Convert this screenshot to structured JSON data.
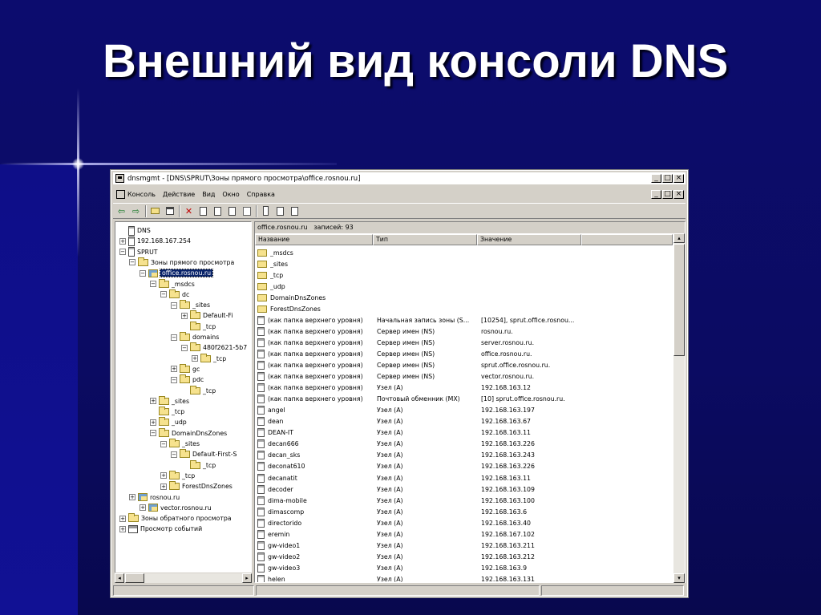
{
  "slide": {
    "title": "Внешний вид консоли DNS"
  },
  "window": {
    "title": "dnsmgmt - [DNS\\SPRUT\\Зоны прямого просмотра\\office.rosnou.ru]",
    "controls": {
      "minimize": "_",
      "maximize": "□",
      "close": "×"
    }
  },
  "menu": {
    "items": [
      "Консоль",
      "Действие",
      "Вид",
      "Окно",
      "Справка"
    ]
  },
  "toolbar": {
    "back": "⇦",
    "forward": "⇨",
    "delete": "✕"
  },
  "tree": {
    "nodes": [
      {
        "label": "DNS",
        "icon": "dns-icon",
        "toggle": ""
      },
      {
        "label": "192.168.167.254",
        "icon": "server-icon",
        "toggle": "+"
      },
      {
        "label": "SPRUT",
        "icon": "server-icon",
        "toggle": "−"
      },
      {
        "label": "Зоны прямого просмотра",
        "icon": "folder-icon",
        "toggle": "−"
      },
      {
        "label": "office.rosnou.ru",
        "icon": "zone-icon",
        "toggle": "−",
        "selected": true
      },
      {
        "label": "_msdcs",
        "icon": "folder-icon",
        "toggle": "−"
      },
      {
        "label": "dc",
        "icon": "folder-icon",
        "toggle": "−"
      },
      {
        "label": "_sites",
        "icon": "folder-icon",
        "toggle": "−"
      },
      {
        "label": "Default-Fi",
        "icon": "folder-icon",
        "toggle": "+"
      },
      {
        "label": "_tcp",
        "icon": "folder-icon",
        "toggle": ""
      },
      {
        "label": "domains",
        "icon": "folder-icon",
        "toggle": "−"
      },
      {
        "label": "480f2621-5b7",
        "icon": "folder-icon",
        "toggle": "−"
      },
      {
        "label": "_tcp",
        "icon": "folder-icon",
        "toggle": "+"
      },
      {
        "label": "gc",
        "icon": "folder-icon",
        "toggle": "+"
      },
      {
        "label": "pdc",
        "icon": "folder-icon",
        "toggle": "−"
      },
      {
        "label": "_tcp",
        "icon": "folder-icon",
        "toggle": ""
      },
      {
        "label": "_sites",
        "icon": "folder-icon",
        "toggle": "+"
      },
      {
        "label": "_tcp",
        "icon": "folder-icon",
        "toggle": ""
      },
      {
        "label": "_udp",
        "icon": "folder-icon",
        "toggle": "+"
      },
      {
        "label": "DomainDnsZones",
        "icon": "folder-icon",
        "toggle": "−"
      },
      {
        "label": "_sites",
        "icon": "folder-icon",
        "toggle": "−"
      },
      {
        "label": "Default-First-S",
        "icon": "folder-icon",
        "toggle": "−"
      },
      {
        "label": "_tcp",
        "icon": "folder-icon",
        "toggle": ""
      },
      {
        "label": "_tcp",
        "icon": "folder-icon",
        "toggle": "+"
      },
      {
        "label": "ForestDnsZones",
        "icon": "folder-icon",
        "toggle": "+"
      },
      {
        "label": "rosnou.ru",
        "icon": "zone-icon",
        "toggle": "+"
      },
      {
        "label": "vector.rosnou.ru",
        "icon": "zone-icon",
        "toggle": "+"
      },
      {
        "label": "Зоны обратного просмотра",
        "icon": "folder-icon",
        "toggle": "+"
      },
      {
        "label": "Просмотр событий",
        "icon": "event-viewer-icon",
        "toggle": "+"
      }
    ]
  },
  "list": {
    "header": "office.rosnou.ru   записей: 93",
    "columns": [
      "Название",
      "Тип",
      "Значение"
    ],
    "rows": [
      {
        "name": "_msdcs",
        "type": "",
        "value": "",
        "icon": "folder-icon"
      },
      {
        "name": "_sites",
        "type": "",
        "value": "",
        "icon": "folder-icon"
      },
      {
        "name": "_tcp",
        "type": "",
        "value": "",
        "icon": "folder-icon"
      },
      {
        "name": "_udp",
        "type": "",
        "value": "",
        "icon": "folder-icon"
      },
      {
        "name": "DomainDnsZones",
        "type": "",
        "value": "",
        "icon": "folder-icon"
      },
      {
        "name": "ForestDnsZones",
        "type": "",
        "value": "",
        "icon": "folder-icon"
      },
      {
        "name": "(как папка верхнего уровня)",
        "type": "Начальная запись зоны (S...",
        "value": "[10254], sprut.office.rosnou...",
        "icon": "record-icon"
      },
      {
        "name": "(как папка верхнего уровня)",
        "type": "Сервер имен (NS)",
        "value": "rosnou.ru.",
        "icon": "record-icon"
      },
      {
        "name": "(как папка верхнего уровня)",
        "type": "Сервер имен (NS)",
        "value": "server.rosnou.ru.",
        "icon": "record-icon"
      },
      {
        "name": "(как папка верхнего уровня)",
        "type": "Сервер имен (NS)",
        "value": "office.rosnou.ru.",
        "icon": "record-icon"
      },
      {
        "name": "(как папка верхнего уровня)",
        "type": "Сервер имен (NS)",
        "value": "sprut.office.rosnou.ru.",
        "icon": "record-icon"
      },
      {
        "name": "(как папка верхнего уровня)",
        "type": "Сервер имен (NS)",
        "value": "vector.rosnou.ru.",
        "icon": "record-icon"
      },
      {
        "name": "(как папка верхнего уровня)",
        "type": "Узел (A)",
        "value": "192.168.163.12",
        "icon": "record-icon"
      },
      {
        "name": "(как папка верхнего уровня)",
        "type": "Почтовый обменник (MX)",
        "value": "[10]  sprut.office.rosnou.ru.",
        "icon": "record-icon"
      },
      {
        "name": "angel",
        "type": "Узел (A)",
        "value": "192.168.163.197",
        "icon": "record-icon"
      },
      {
        "name": "dean",
        "type": "Узел (A)",
        "value": "192.168.163.67",
        "icon": "record-icon"
      },
      {
        "name": "DEAN-IT",
        "type": "Узел (A)",
        "value": "192.168.163.11",
        "icon": "record-icon"
      },
      {
        "name": "decan666",
        "type": "Узел (A)",
        "value": "192.168.163.226",
        "icon": "record-icon"
      },
      {
        "name": "decan_sks",
        "type": "Узел (A)",
        "value": "192.168.163.243",
        "icon": "record-icon"
      },
      {
        "name": "deconat610",
        "type": "Узел (A)",
        "value": "192.168.163.226",
        "icon": "record-icon"
      },
      {
        "name": "decanatit",
        "type": "Узел (A)",
        "value": "192.168.163.11",
        "icon": "record-icon"
      },
      {
        "name": "decoder",
        "type": "Узел (A)",
        "value": "192.168.163.109",
        "icon": "record-icon"
      },
      {
        "name": "dima-mobile",
        "type": "Узел (A)",
        "value": "192.168.163.100",
        "icon": "record-icon"
      },
      {
        "name": "dimascomp",
        "type": "Узел (A)",
        "value": "192.168.163.6",
        "icon": "record-icon"
      },
      {
        "name": "directorido",
        "type": "Узел (A)",
        "value": "192.168.163.40",
        "icon": "record-icon"
      },
      {
        "name": "eremin",
        "type": "Узел (A)",
        "value": "192.168.167.102",
        "icon": "record-icon"
      },
      {
        "name": "gw-video1",
        "type": "Узел (A)",
        "value": "192.168.163.211",
        "icon": "record-icon"
      },
      {
        "name": "gw-video2",
        "type": "Узел (A)",
        "value": "192.168.163.212",
        "icon": "record-icon"
      },
      {
        "name": "gw-video3",
        "type": "Узел (A)",
        "value": "192.168.163.9",
        "icon": "record-icon"
      },
      {
        "name": "helen",
        "type": "Узел (A)",
        "value": "192.168.163.131",
        "icon": "record-icon"
      }
    ]
  }
}
